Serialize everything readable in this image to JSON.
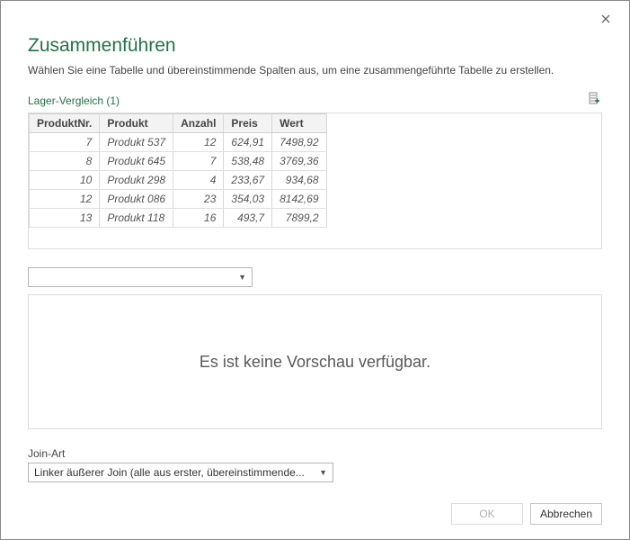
{
  "dialog": {
    "title": "Zusammenführen",
    "subtitle": "Wählen Sie eine Tabelle und übereinstimmende Spalten aus, um eine zusammengeführte Tabelle zu erstellen."
  },
  "firstTable": {
    "name": "Lager-Vergleich (1)",
    "headers": [
      "ProduktNr.",
      "Produkt",
      "Anzahl",
      "Preis",
      "Wert"
    ],
    "rows": [
      {
        "nr": "7",
        "produkt": "Produkt 537",
        "anzahl": "12",
        "preis": "624,91",
        "wert": "7498,92"
      },
      {
        "nr": "8",
        "produkt": "Produkt 645",
        "anzahl": "7",
        "preis": "538,48",
        "wert": "3769,36"
      },
      {
        "nr": "10",
        "produkt": "Produkt 298",
        "anzahl": "4",
        "preis": "233,67",
        "wert": "934,68"
      },
      {
        "nr": "12",
        "produkt": "Produkt 086",
        "anzahl": "23",
        "preis": "354,03",
        "wert": "8142,69"
      },
      {
        "nr": "13",
        "produkt": "Produkt 118",
        "anzahl": "16",
        "preis": "493,7",
        "wert": "7899,2"
      }
    ]
  },
  "secondTableDropdown": {
    "selected": ""
  },
  "preview": {
    "emptyText": "Es ist keine Vorschau verfügbar."
  },
  "joinType": {
    "label": "Join-Art",
    "selected": "Linker äußerer Join (alle aus erster, übereinstimmende..."
  },
  "buttons": {
    "ok": "OK",
    "cancel": "Abbrechen"
  }
}
